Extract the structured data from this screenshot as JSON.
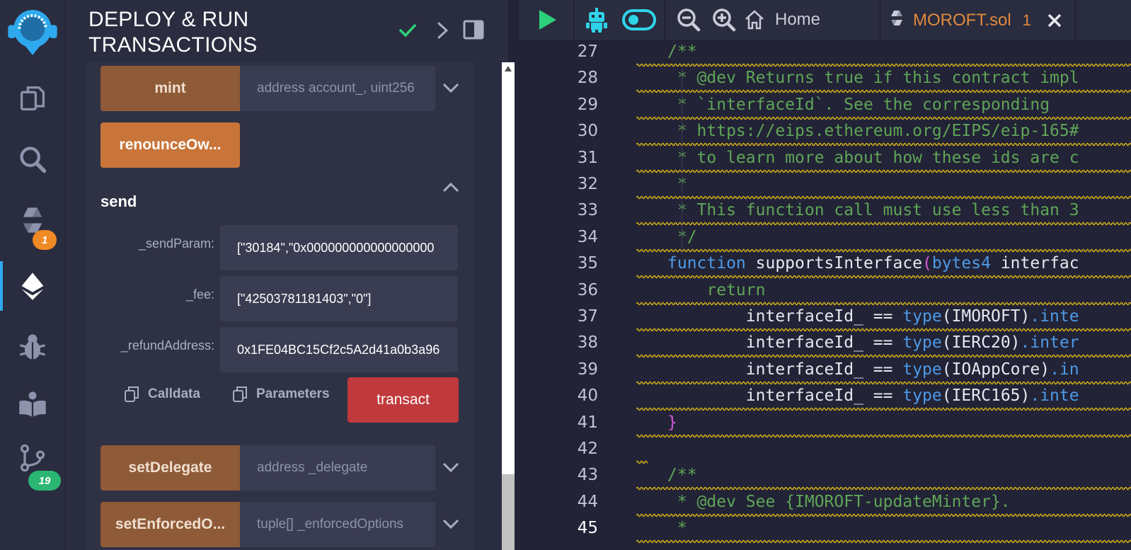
{
  "panel": {
    "title_line1": "DEPLOY & RUN",
    "title_line2": "TRANSACTIONS"
  },
  "functions": {
    "mint": {
      "label": "mint",
      "placeholder": "address account_, uint256"
    },
    "renounce": {
      "label": "renounceOw..."
    },
    "send": {
      "title": "send",
      "params": [
        {
          "label": "_sendParam:",
          "value": "[\"30184\",\"0x000000000000000000"
        },
        {
          "label": "_fee:",
          "value": "[\"42503781181403\",\"0\"]"
        },
        {
          "label": "_refundAddress:",
          "value": "0x1FE04BC15Cf2c5A2d41a0b3a96"
        }
      ],
      "calldata_label": "Calldata",
      "parameters_label": "Parameters",
      "transact_label": "transact"
    },
    "setDelegate": {
      "label": "setDelegate",
      "placeholder": "address _delegate"
    },
    "setEnforced": {
      "label": "setEnforcedO...",
      "placeholder": "tuple[] _enforcedOptions"
    }
  },
  "rail": {
    "badge_solidity": "1",
    "badge_git": "19"
  },
  "editor": {
    "home_label": "Home",
    "file_tab": {
      "name": "MOROFT.sol",
      "count": "1"
    },
    "lines": [
      {
        "n": "27",
        "parts": [
          [
            "c-com",
            "/**"
          ]
        ]
      },
      {
        "n": "28",
        "parts": [
          [
            "c-com",
            " * @dev Returns true if this contract impl"
          ]
        ]
      },
      {
        "n": "29",
        "parts": [
          [
            "c-com",
            " * `interfaceId`. See the corresponding"
          ]
        ]
      },
      {
        "n": "30",
        "parts": [
          [
            "c-com",
            " * https://eips.ethereum.org/EIPS/eip-165#"
          ]
        ]
      },
      {
        "n": "31",
        "parts": [
          [
            "c-com",
            " * to learn more about how these ids are c"
          ]
        ]
      },
      {
        "n": "32",
        "parts": [
          [
            "c-com",
            " *"
          ]
        ]
      },
      {
        "n": "33",
        "parts": [
          [
            "c-com",
            " * This function call must use less than 3"
          ]
        ]
      },
      {
        "n": "34",
        "parts": [
          [
            "c-com",
            " */"
          ]
        ]
      },
      {
        "n": "35",
        "parts": [
          [
            "c-kw",
            "function"
          ],
          [
            "c-fn",
            " supportsInterface"
          ],
          [
            "c-par",
            "("
          ],
          [
            "c-ty",
            "bytes4"
          ],
          [
            "c-fn",
            " interfac"
          ]
        ]
      },
      {
        "n": "36",
        "parts": [
          [
            "c-ret",
            "    return"
          ]
        ]
      },
      {
        "n": "37",
        "parts": [
          [
            "c-fn",
            "        interfaceId_ == "
          ],
          [
            "c-ty",
            "type"
          ],
          [
            "c-fn",
            "(IMOROFT)"
          ],
          [
            "c-ty",
            ".inte"
          ]
        ]
      },
      {
        "n": "38",
        "parts": [
          [
            "c-fn",
            "        interfaceId_ == "
          ],
          [
            "c-ty",
            "type"
          ],
          [
            "c-fn",
            "(IERC20)"
          ],
          [
            "c-ty",
            ".inter"
          ]
        ]
      },
      {
        "n": "39",
        "parts": [
          [
            "c-fn",
            "        interfaceId_ == "
          ],
          [
            "c-ty",
            "type"
          ],
          [
            "c-fn",
            "(IOAppCore)"
          ],
          [
            "c-ty",
            ".in"
          ]
        ]
      },
      {
        "n": "40",
        "parts": [
          [
            "c-fn",
            "        interfaceId_ == "
          ],
          [
            "c-ty",
            "type"
          ],
          [
            "c-fn",
            "(IERC165)"
          ],
          [
            "c-ty",
            ".inte"
          ]
        ]
      },
      {
        "n": "41",
        "parts": [
          [
            "c-par",
            "}"
          ]
        ]
      },
      {
        "n": "42",
        "parts": []
      },
      {
        "n": "43",
        "parts": [
          [
            "c-com",
            "/**"
          ]
        ]
      },
      {
        "n": "44",
        "parts": [
          [
            "c-com",
            " * @dev See {IMOROFT-updateMinter}."
          ]
        ]
      },
      {
        "n": "45",
        "parts": [
          [
            "c-com",
            " *"
          ]
        ]
      }
    ]
  },
  "colors": {
    "accent_green": "#2dd07a",
    "accent_cyan": "#2fd3e8",
    "tab_orange": "#e08a3c",
    "transact_red": "#c0393c",
    "squiggle": "#d6b019"
  }
}
